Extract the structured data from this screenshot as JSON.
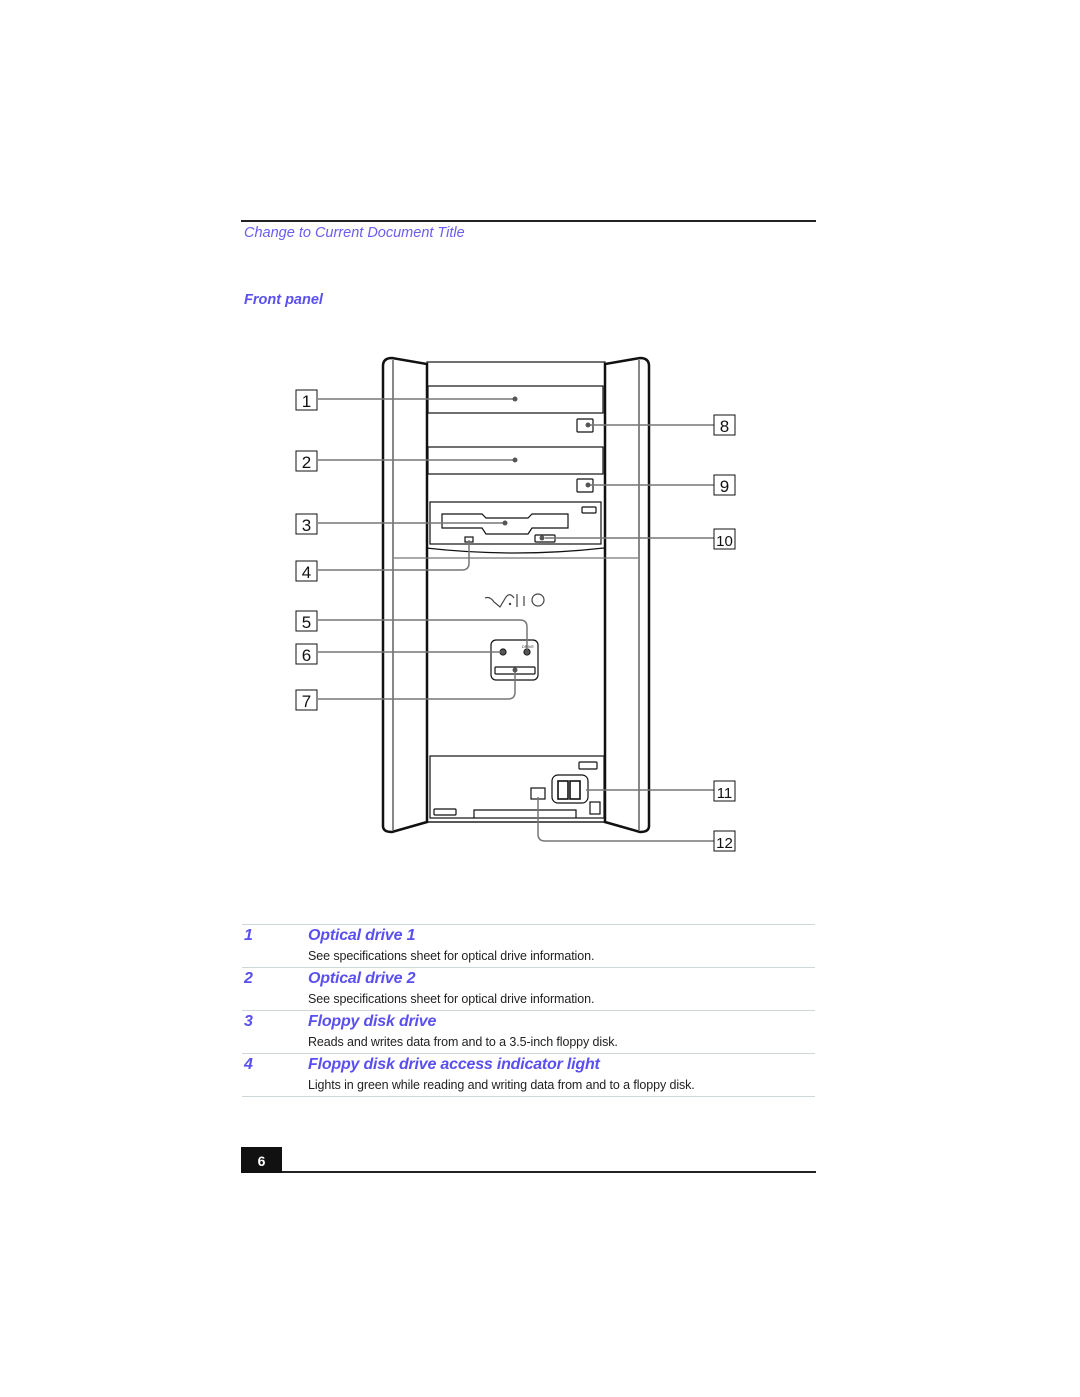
{
  "header": {
    "document_title": "Change to Current Document Title"
  },
  "section": {
    "heading": "Front panel"
  },
  "diagram": {
    "callouts": [
      "1",
      "2",
      "3",
      "4",
      "5",
      "6",
      "7",
      "8",
      "9",
      "10",
      "11",
      "12"
    ],
    "logo_text": "VAIO",
    "drive_label": "DRIVE"
  },
  "items": [
    {
      "number": "1",
      "title": "Optical drive 1",
      "description": "See specifications sheet for optical drive information."
    },
    {
      "number": "2",
      "title": "Optical drive 2",
      "description": "See specifications sheet for optical drive information."
    },
    {
      "number": "3",
      "title": "Floppy disk drive",
      "description": "Reads and writes data from and to a 3.5-inch floppy disk."
    },
    {
      "number": "4",
      "title": "Floppy disk drive access indicator light",
      "description": "Lights in green while reading and writing data from and to a floppy disk."
    }
  ],
  "footer": {
    "page_number": "6"
  },
  "colors": {
    "accent": "#5a4ff0",
    "rule": "#222222",
    "table_divider": "#cfd6da"
  }
}
